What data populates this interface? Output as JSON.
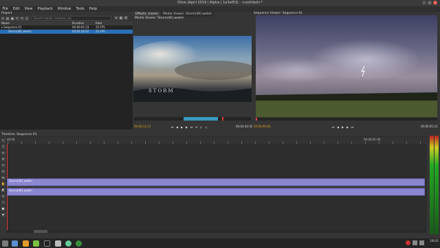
{
  "window": {
    "title": "Olive (April 2019 | Alpha | 1e3ef53) - <untitled>*"
  },
  "menu": [
    "File",
    "Edit",
    "View",
    "Playback",
    "Window",
    "Tools",
    "Help"
  ],
  "project": {
    "label": "Project",
    "search_placeholder": "Search media, markers, etc.",
    "columns": [
      "Name",
      "Duration",
      "Rate"
    ],
    "rows": [
      {
        "name": "Sequence 01",
        "duration": "00:00:01:23",
        "rate": "25 FPS"
      },
      {
        "name": "Storm(4K).webm",
        "duration": "00:04:44:02",
        "rate": "25 FPS"
      }
    ]
  },
  "media_viewer": {
    "tabs": [
      "Effects: (none)",
      "Media Viewer: Storm(4K).webm"
    ],
    "title": "Media Viewer: Storm(4K).webm",
    "in_tc": "00:00:12:11",
    "dur_tc": "00:04:44:02",
    "watermark": "STORM"
  },
  "sequence_viewer": {
    "label": "Sequence Viewer: Sequence 01",
    "tc": "00:00:00:00",
    "dur_tc": "00:00:05:23"
  },
  "timeline": {
    "label": "Timeline: Sequence 01",
    "ruler_start": "00:00",
    "ruler_mark": "00:00:01:00",
    "video_clip": "Storm(4K).webm",
    "audio_clip": "Storm(4K).webm"
  },
  "taskbar": {
    "clock": "18:02"
  },
  "colors": {
    "accent": "#2a6fb5",
    "clip": "#8a87d0",
    "playhead": "#e23b3b",
    "timecode": "#e3a21a"
  }
}
